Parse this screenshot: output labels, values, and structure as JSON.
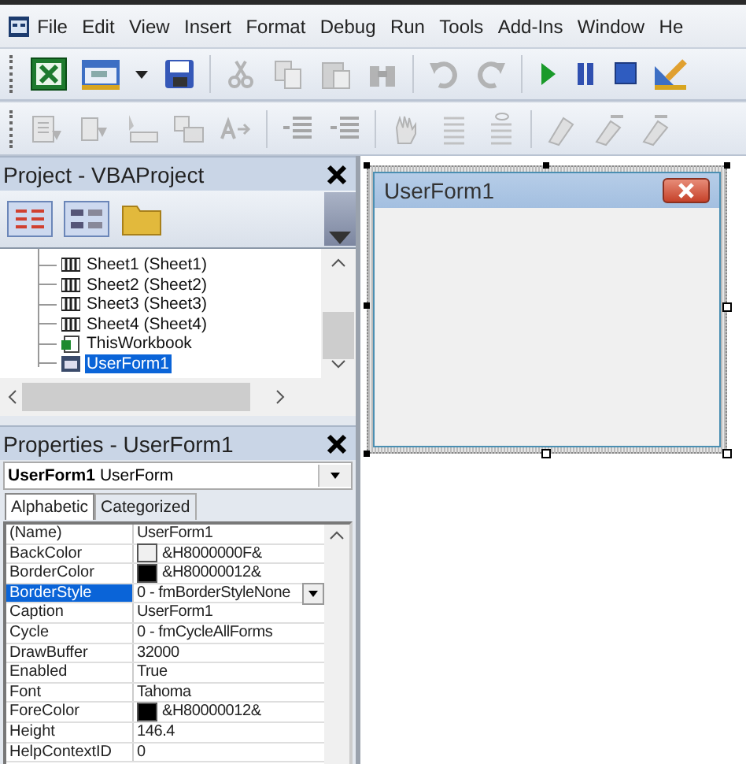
{
  "menu": [
    "File",
    "Edit",
    "View",
    "Insert",
    "Format",
    "Debug",
    "Run",
    "Tools",
    "Add-Ins",
    "Window",
    "He"
  ],
  "project": {
    "title": "Project - VBAProject",
    "tree": [
      {
        "label": "Sheet1 (Sheet1)",
        "kind": "sheet",
        "selected": false
      },
      {
        "label": "Sheet2 (Sheet2)",
        "kind": "sheet",
        "selected": false
      },
      {
        "label": "Sheet3 (Sheet3)",
        "kind": "sheet",
        "selected": false
      },
      {
        "label": "Sheet4 (Sheet4)",
        "kind": "sheet",
        "selected": false
      },
      {
        "label": "ThisWorkbook",
        "kind": "workbook",
        "selected": false
      },
      {
        "label": "UserForm1",
        "kind": "form",
        "selected": true
      }
    ]
  },
  "properties": {
    "title": "Properties - UserForm1",
    "object_name": "UserForm1",
    "object_type": "UserForm",
    "tabs": [
      {
        "label": "Alphabetic",
        "selected": true
      },
      {
        "label": "Categorized",
        "selected": false
      }
    ],
    "rows": [
      {
        "name": "(Name)",
        "value": "UserForm1",
        "selected": false
      },
      {
        "name": "BackColor",
        "value": "&H8000000F&",
        "color": "#f0f0f0",
        "selected": false
      },
      {
        "name": "BorderColor",
        "value": "&H80000012&",
        "color": "#000000",
        "selected": false
      },
      {
        "name": "BorderStyle",
        "value": "0 - fmBorderStyleNone",
        "selected": true
      },
      {
        "name": "Caption",
        "value": "UserForm1",
        "selected": false
      },
      {
        "name": "Cycle",
        "value": "0 - fmCycleAllForms",
        "selected": false
      },
      {
        "name": "DrawBuffer",
        "value": "32000",
        "selected": false
      },
      {
        "name": "Enabled",
        "value": "True",
        "selected": false
      },
      {
        "name": "Font",
        "value": "Tahoma",
        "selected": false
      },
      {
        "name": "ForeColor",
        "value": "&H80000012&",
        "color": "#000000",
        "selected": false
      },
      {
        "name": "Height",
        "value": "146.4",
        "selected": false
      },
      {
        "name": "HelpContextID",
        "value": "0",
        "selected": false
      }
    ]
  },
  "userform": {
    "title": "UserForm1"
  }
}
